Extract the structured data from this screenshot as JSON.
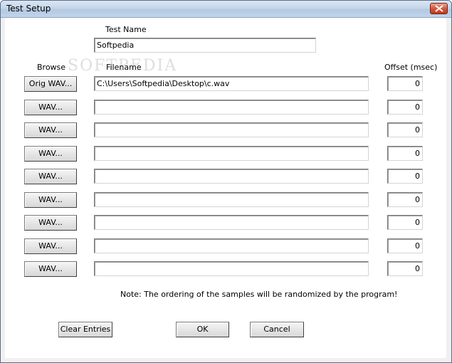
{
  "window": {
    "title": "Test Setup"
  },
  "test_name": {
    "label": "Test Name",
    "value": "Softpedia"
  },
  "headers": {
    "browse": "Browse",
    "filename": "Filename",
    "offset": "Offset (msec)"
  },
  "rows": [
    {
      "button": "Orig WAV...",
      "filename": "C:\\Users\\Softpedia\\Desktop\\c.wav",
      "offset": "0"
    },
    {
      "button": "WAV...",
      "filename": "",
      "offset": "0"
    },
    {
      "button": "WAV...",
      "filename": "",
      "offset": "0"
    },
    {
      "button": "WAV...",
      "filename": "",
      "offset": "0"
    },
    {
      "button": "WAV...",
      "filename": "",
      "offset": "0"
    },
    {
      "button": "WAV...",
      "filename": "",
      "offset": "0"
    },
    {
      "button": "WAV...",
      "filename": "",
      "offset": "0"
    },
    {
      "button": "WAV...",
      "filename": "",
      "offset": "0"
    },
    {
      "button": "WAV...",
      "filename": "",
      "offset": "0"
    }
  ],
  "note": "Note: The ordering of the samples will be randomized by the program!",
  "buttons": {
    "clear": "Clear Entries",
    "ok": "OK",
    "cancel": "Cancel"
  },
  "watermark": "SOFTPEDIA"
}
